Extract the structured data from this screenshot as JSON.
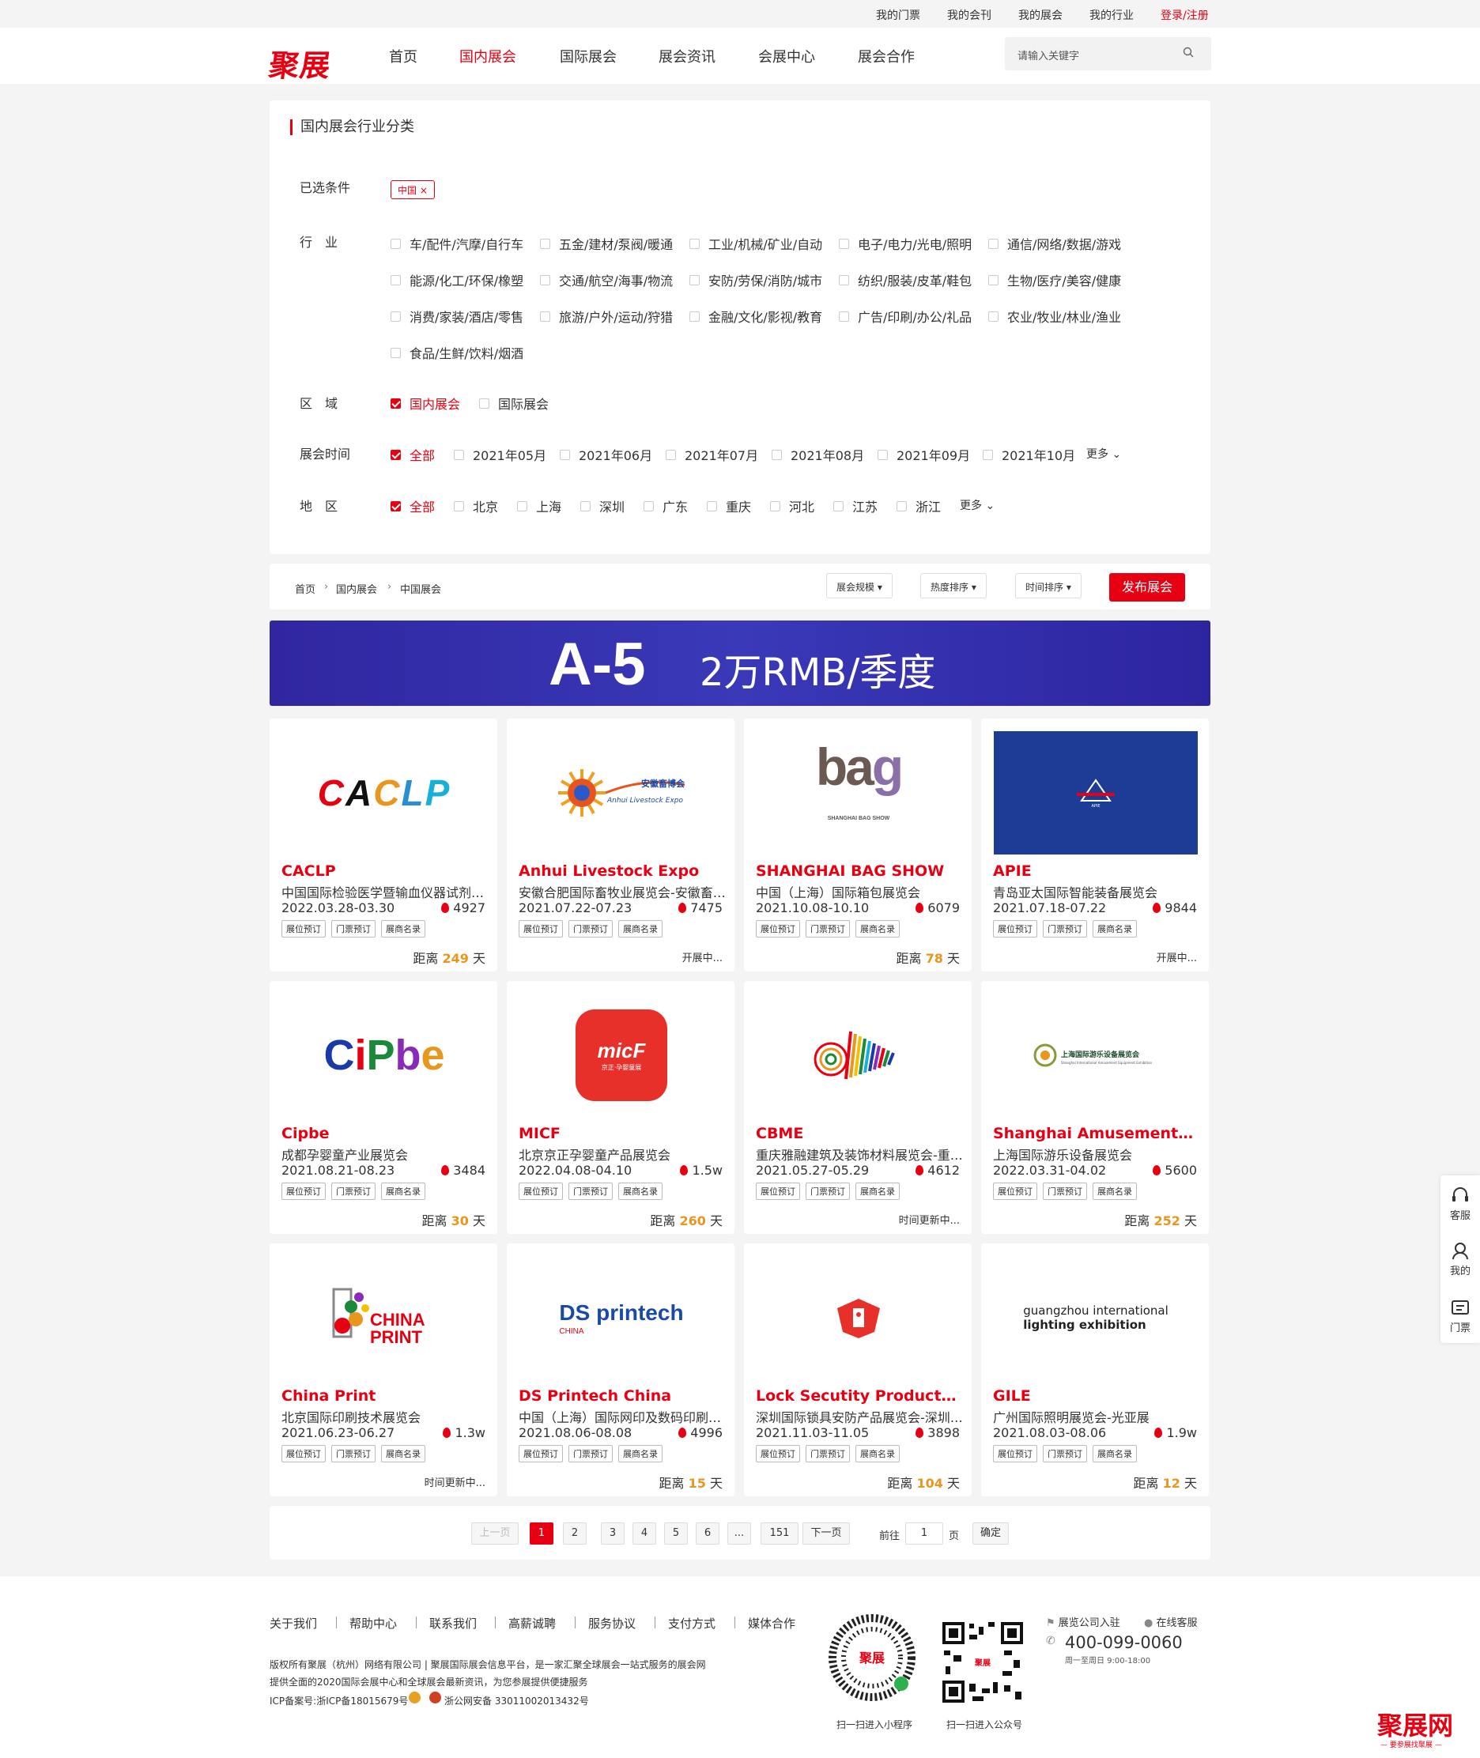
{
  "topbar": {
    "links": [
      "我的门票",
      "我的会刊",
      "我的展会",
      "我的行业"
    ],
    "login": "登录/注册"
  },
  "header": {
    "logo": "聚展",
    "nav": [
      "首页",
      "国内展会",
      "国际展会",
      "展会资讯",
      "会展中心",
      "展会合作"
    ],
    "search_placeholder": "请输入关键字"
  },
  "filter": {
    "title": "国内展会行业分类",
    "selected_label": "已选条件",
    "selected_chip": "中国 ×",
    "industry_label": "行　业",
    "industries": [
      "车/配件/汽摩/自行车",
      "五金/建材/泵阀/暖通",
      "工业/机械/矿业/自动",
      "电子/电力/光电/照明",
      "通信/网络/数据/游戏",
      "能源/化工/环保/橡塑",
      "交通/航空/海事/物流",
      "安防/劳保/消防/城市",
      "纺织/服装/皮革/鞋包",
      "生物/医疗/美容/健康",
      "消费/家装/酒店/零售",
      "旅游/户外/运动/狩猎",
      "金融/文化/影视/教育",
      "广告/印刷/办公/礼品",
      "农业/牧业/林业/渔业",
      "食品/生鲜/饮料/烟酒"
    ],
    "region_label": "区　域",
    "regions": [
      "国内展会",
      "国际展会"
    ],
    "time_label": "展会时间",
    "times": [
      "全部",
      "2021年05月",
      "2021年06月",
      "2021年07月",
      "2021年08月",
      "2021年09月",
      "2021年10月"
    ],
    "time_more": "更多",
    "area_label": "地　区",
    "areas": [
      "全部",
      "北京",
      "上海",
      "深圳",
      "广东",
      "重庆",
      "河北",
      "江苏",
      "浙江"
    ],
    "area_more": "更多"
  },
  "breadcrumb": [
    "首页",
    "国内展会",
    "中国展会"
  ],
  "sorts": [
    "展会规模",
    "热度排序",
    "时间排序"
  ],
  "publish": "发布展会",
  "banner": {
    "code": "A-5",
    "price": "2万RMB/季度"
  },
  "tags": [
    "展位预订",
    "门票预订",
    "展商名录"
  ],
  "cards": [
    {
      "en": "CACLP",
      "cn": "中国国际检验医学暨输血仪器试剂博览会",
      "date": "2022.03.28-03.30",
      "hot": "4927",
      "dist_prefix": "距离",
      "dist": "249",
      "dist_suffix": "天",
      "logo": "CACLP"
    },
    {
      "en": "Anhui Livestock Expo",
      "cn": "安徽合肥国际畜牧业展览会-安徽畜博会",
      "date": "2021.07.22-07.23",
      "hot": "7475",
      "status": "开展中...",
      "logo": "安徽畜博会"
    },
    {
      "en": "SHANGHAI BAG SHOW",
      "cn": "中国（上海）国际箱包展览会",
      "date": "2021.10.08-10.10",
      "hot": "6079",
      "dist_prefix": "距离",
      "dist": "78",
      "dist_suffix": "天",
      "logo": "bag"
    },
    {
      "en": "APIE",
      "cn": "青岛亚太国际智能装备展览会",
      "date": "2021.07.18-07.22",
      "hot": "9844",
      "status": "开展中...",
      "logo": "APIE"
    },
    {
      "en": "Cipbe",
      "cn": "成都孕婴童产业展览会",
      "date": "2021.08.21-08.23",
      "hot": "3484",
      "dist_prefix": "距离",
      "dist": "30",
      "dist_suffix": "天",
      "logo": "Cipbe"
    },
    {
      "en": "MICF",
      "cn": "北京京正孕婴童产品展览会",
      "date": "2022.04.08-04.10",
      "hot": "1.5w",
      "dist_prefix": "距离",
      "dist": "260",
      "dist_suffix": "天",
      "logo": "micF"
    },
    {
      "en": "CBME",
      "cn": "重庆雅融建筑及装饰材料展览会-重庆建博会",
      "date": "2021.05.27-05.29",
      "hot": "4612",
      "status": "时间更新中...",
      "logo": "CBME"
    },
    {
      "en": "Shanghai Amusement Equipment",
      "cn": "上海国际游乐设备展览会",
      "date": "2022.03.31-04.02",
      "hot": "5600",
      "dist_prefix": "距离",
      "dist": "252",
      "dist_suffix": "天",
      "logo": "上海国际游乐设备展览会"
    },
    {
      "en": "China Print",
      "cn": "北京国际印刷技术展览会",
      "date": "2021.06.23-06.27",
      "hot": "1.3w",
      "status": "时间更新中...",
      "logo": "CHINA PRINT"
    },
    {
      "en": "DS Printech China",
      "cn": "中国（上海）国际网印及数码印刷展览会",
      "date": "2021.08.06-08.08",
      "hot": "4996",
      "dist_prefix": "距离",
      "dist": "15",
      "dist_suffix": "天",
      "logo": "DS printech"
    },
    {
      "en": "Lock Secutity Products Expo",
      "cn": "深圳国际锁具安防产品展览会-深圳锁博会",
      "date": "2021.11.03-11.05",
      "hot": "3898",
      "dist_prefix": "距离",
      "dist": "104",
      "dist_suffix": "天",
      "logo": "lock"
    },
    {
      "en": "GILE",
      "cn": "广州国际照明展览会-光亚展",
      "date": "2021.08.03-08.06",
      "hot": "1.9w",
      "dist_prefix": "距离",
      "dist": "12",
      "dist_suffix": "天",
      "logo": "guangzhou international lighting exhibition"
    }
  ],
  "pagination": {
    "prev": "上一页",
    "pages": [
      "1",
      "2",
      "3",
      "4",
      "5",
      "6",
      "...",
      "151"
    ],
    "next": "下一页",
    "goto": "前往",
    "page_value": "1",
    "page_unit": "页",
    "confirm": "确定"
  },
  "footer": {
    "links": [
      "关于我们",
      "帮助中心",
      "联系我们",
      "高薪诚聘",
      "服务协议",
      "支付方式",
      "媒体合作"
    ],
    "copyright1": "版权所有聚展（杭州）网络有限公司 | 聚展国际展会信息平台，是一家汇聚全球展会一站式服务的展会网",
    "copyright2": "提供全面的2020国际会展中心和全球展会最新资讯，为您参展提供便捷服务",
    "icp": "ICP备案号:浙ICP备18015679号",
    "police": "浙公网安备 33011002013432号",
    "qr1": "扫一扫进入小程序",
    "qr2": "扫一扫进入公众号",
    "join": "展览公司入驻",
    "service": "在线客服",
    "phone": "400-099-0060",
    "hours": "周一至周日 9:00-18:00",
    "brand": "聚展网",
    "slogan": "— 要参展找聚展 —"
  },
  "side": [
    "客服",
    "我的",
    "门票"
  ]
}
